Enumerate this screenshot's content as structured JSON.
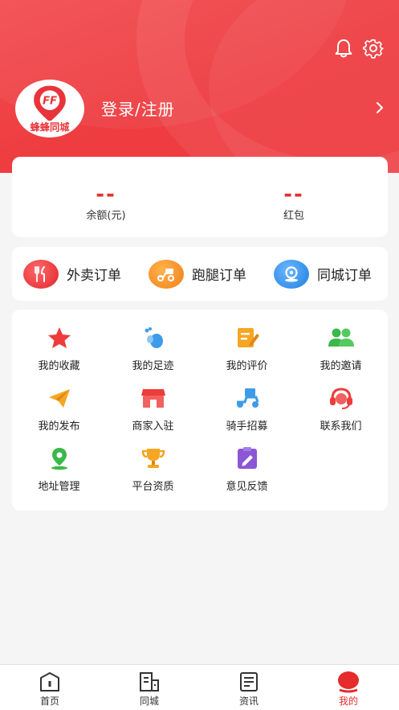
{
  "header": {
    "login_label": "登录/注册",
    "logo_text": "蜂蜂同城",
    "logo_mark": "FF"
  },
  "balance": {
    "items": [
      {
        "value": "--",
        "label": "余额(元)"
      },
      {
        "value": "--",
        "label": "红包"
      }
    ]
  },
  "orders": [
    {
      "label": "外卖订单",
      "icon": "fork-knife-icon",
      "color": "#e8343a"
    },
    {
      "label": "跑腿订单",
      "icon": "scooter-icon",
      "color": "#f08a23"
    },
    {
      "label": "同城订单",
      "icon": "location-icon",
      "color": "#2f8ee8"
    }
  ],
  "menu": [
    {
      "label": "我的收藏",
      "icon": "star-icon"
    },
    {
      "label": "我的足迹",
      "icon": "footprint-icon"
    },
    {
      "label": "我的评价",
      "icon": "edit-note-icon"
    },
    {
      "label": "我的邀请",
      "icon": "users-icon"
    },
    {
      "label": "我的发布",
      "icon": "paper-plane-icon"
    },
    {
      "label": "商家入驻",
      "icon": "shop-icon"
    },
    {
      "label": "骑手招募",
      "icon": "delivery-bike-icon"
    },
    {
      "label": "联系我们",
      "icon": "headset-icon"
    },
    {
      "label": "地址管理",
      "icon": "map-pin-icon"
    },
    {
      "label": "平台资质",
      "icon": "trophy-icon"
    },
    {
      "label": "意见反馈",
      "icon": "feedback-icon"
    }
  ],
  "tabs": [
    {
      "label": "首页",
      "icon": "home-icon"
    },
    {
      "label": "同城",
      "icon": "city-icon"
    },
    {
      "label": "资讯",
      "icon": "news-icon"
    },
    {
      "label": "我的",
      "icon": "profile-icon",
      "active": true
    }
  ],
  "colors": {
    "brand": "#ee3c40",
    "accent_text": "#e23232"
  }
}
